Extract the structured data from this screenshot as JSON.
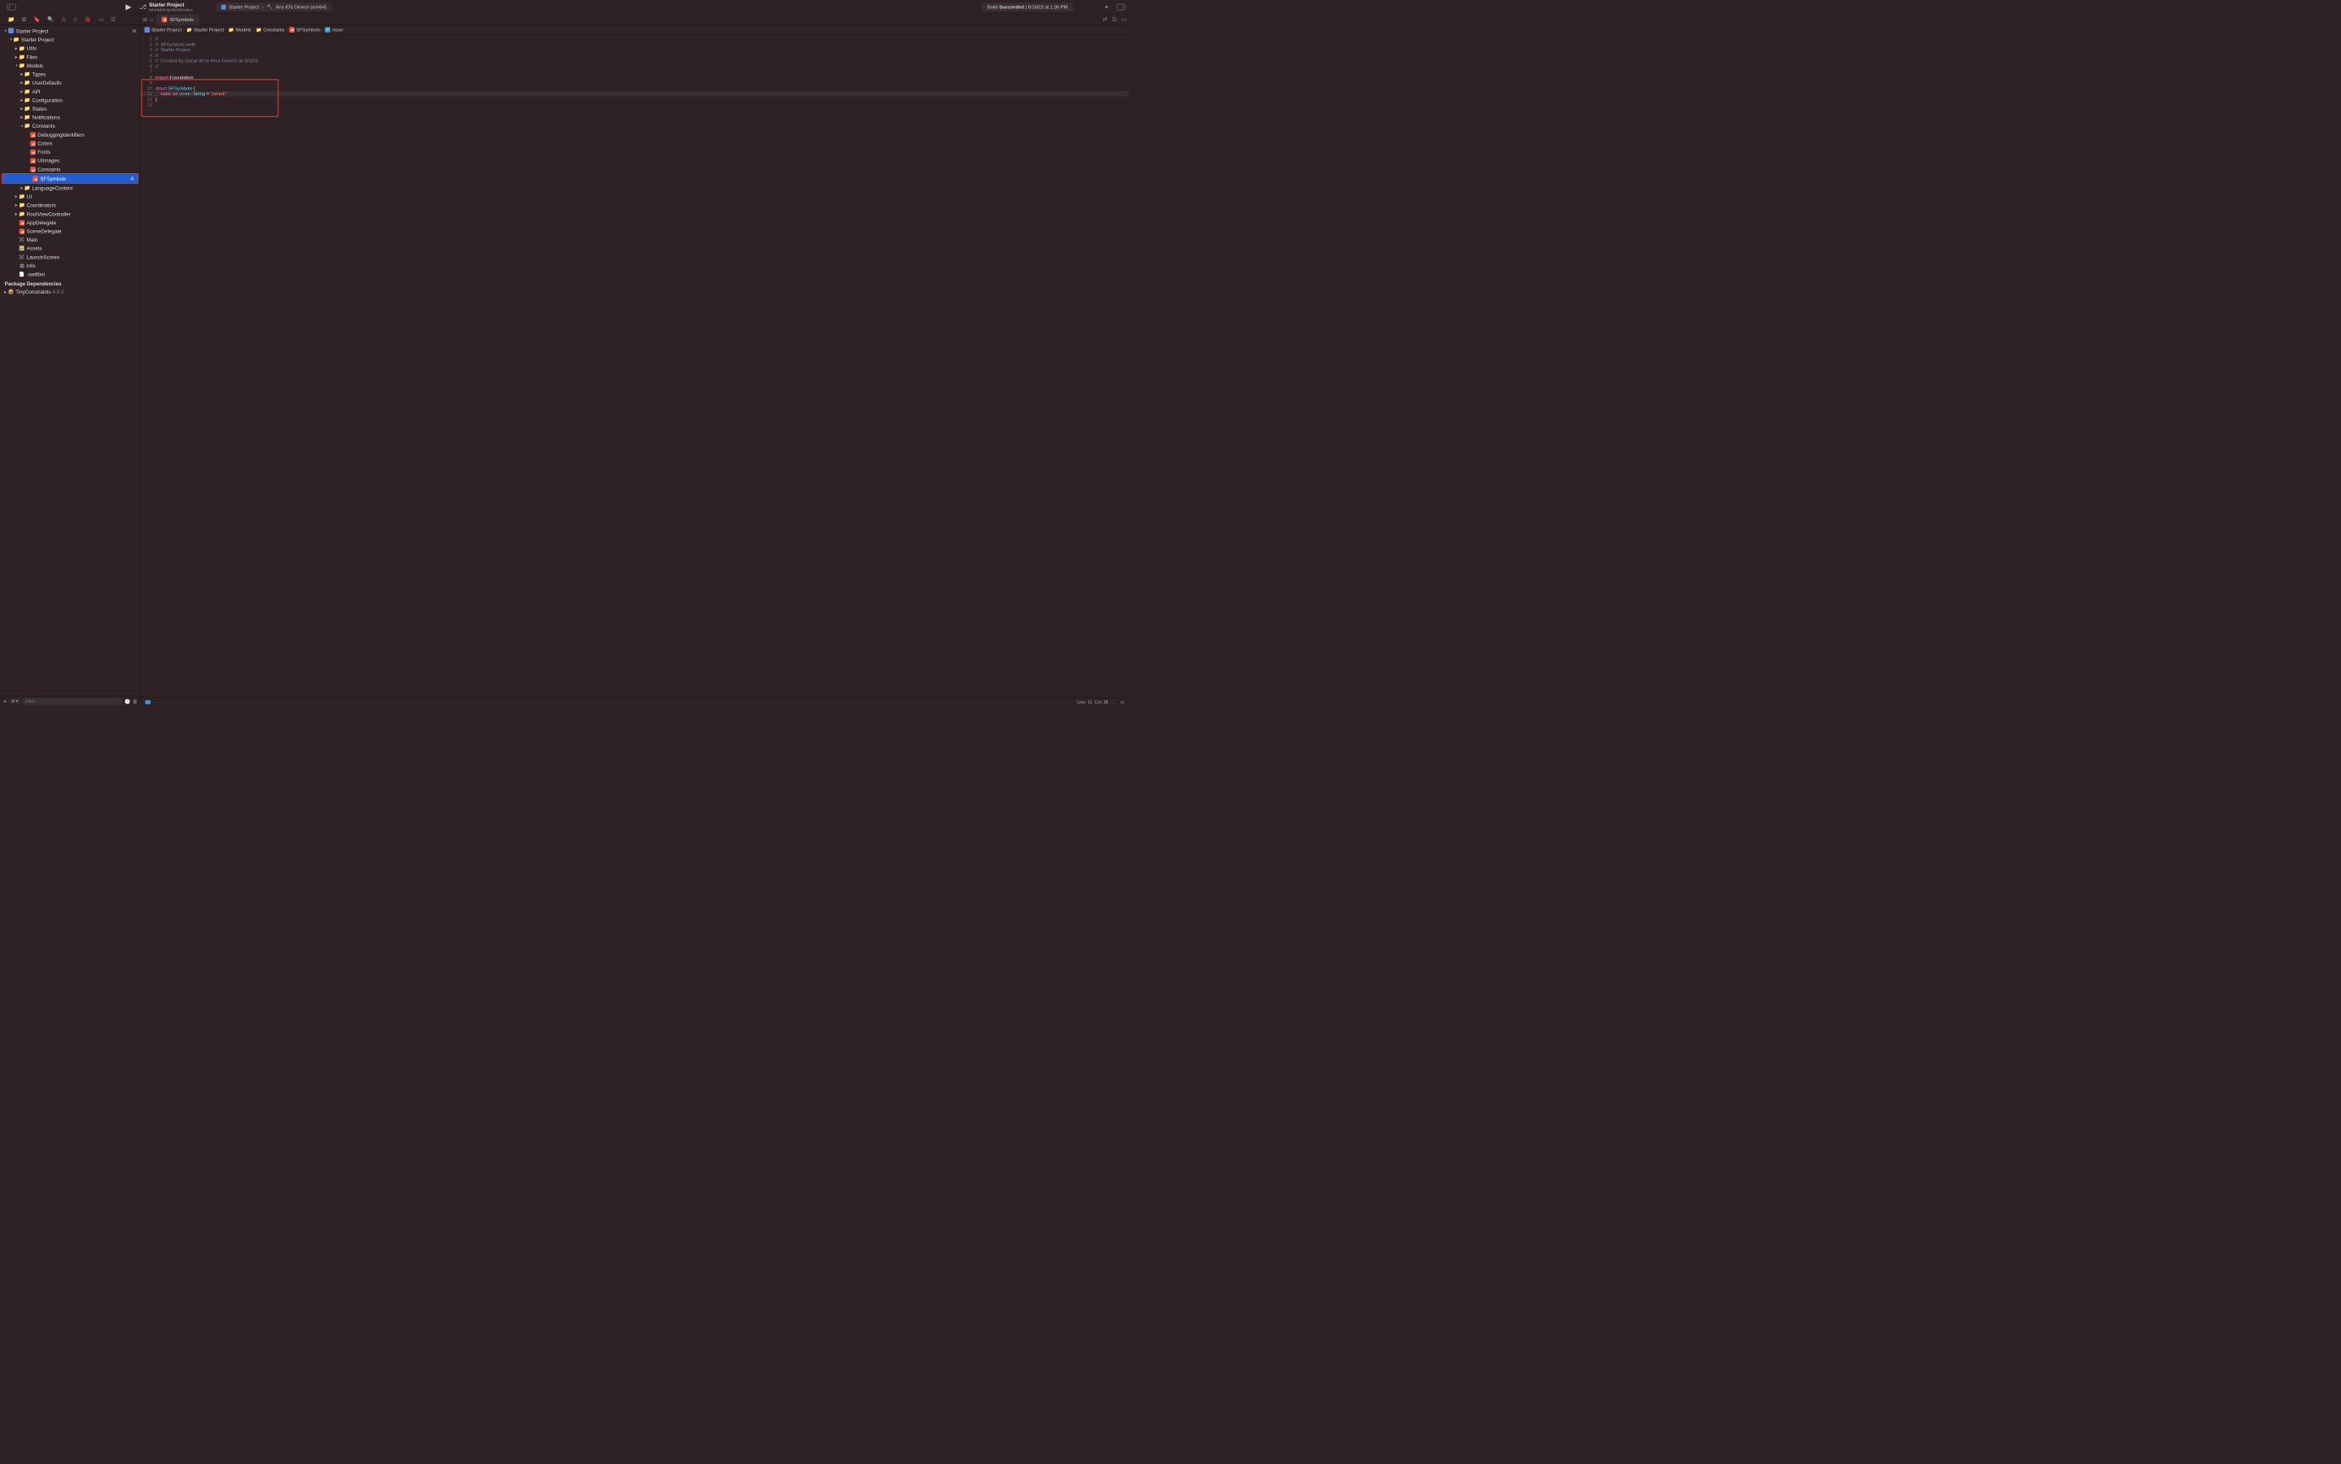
{
  "toolbar": {
    "project_title": "Starter Project",
    "branch": "tutorial/sf-symbols/basics",
    "scheme_project": "Starter Project",
    "scheme_device": "Any iOS Device (arm64)",
    "build_label": "Build",
    "build_status": "Succeeded",
    "build_time": "6/16/23 at 1:35 PM"
  },
  "navigator": {
    "root": "Starter Project",
    "root_badge": "M",
    "folder1": "Starter Project",
    "utils": "Utils",
    "files": "Files",
    "models": "Models",
    "types": "Types",
    "userdefaults": "UserDefaults",
    "api": "API",
    "configuration": "Configuration",
    "states": "States",
    "notifications": "Notifications",
    "constants": "Constants",
    "debugging": "DebuggingIdentifiers",
    "colors": "Colors",
    "fonts": "Fonts",
    "uiimages": "UIImages",
    "constants_file": "Constants",
    "sfsymbols": "SFSymbols",
    "sfsymbols_badge": "A",
    "langcontent": "LanguageContent",
    "ui": "UI",
    "coordinators": "Coordinators",
    "rootvc": "RootViewController",
    "appdelegate": "AppDelegate",
    "scenedelegate": "SceneDelegate",
    "main": "Main",
    "assets": "Assets",
    "launch": "LaunchScreen",
    "info": "Info",
    "swiftlint": ".swiftlint",
    "pkg_header": "Package Dependencies",
    "tinyconstraints": "TinyConstraints",
    "tinyconstraints_ver": "4.0.2",
    "filter_placeholder": "Filter"
  },
  "editor": {
    "tab": "SFSymbols",
    "jump": {
      "proj": "Starter Project",
      "folder1": "Starter Project",
      "models": "Models",
      "constants": "Constants",
      "file": "SFSymbols",
      "symbol": "close"
    },
    "lines": {
      "l1": "//",
      "l2": "//  SFSymbols.swift",
      "l3": "//  Starter Project",
      "l4": "//",
      "l5": "//  Created by Oscar de la Hera Gomez on 9/3/23.",
      "l6": "//",
      "l7": "",
      "l8_kw": "import",
      "l8_mod": " Foundation",
      "l9": "",
      "l10_kw": "struct",
      "l10_ty": " SFSymbols ",
      "l10_br": "{",
      "l11_kw1": "    static",
      "l11_kw2": " let",
      "l11_id": " close",
      "l11_col": ": ",
      "l11_ty": "String",
      "l11_eq": " = ",
      "l11_str": "\"xmark\"",
      "l12": "}",
      "l13": ""
    }
  },
  "statusbar": {
    "line_label": "Line:",
    "line": "11",
    "col_label": "Col:",
    "col": "38"
  }
}
